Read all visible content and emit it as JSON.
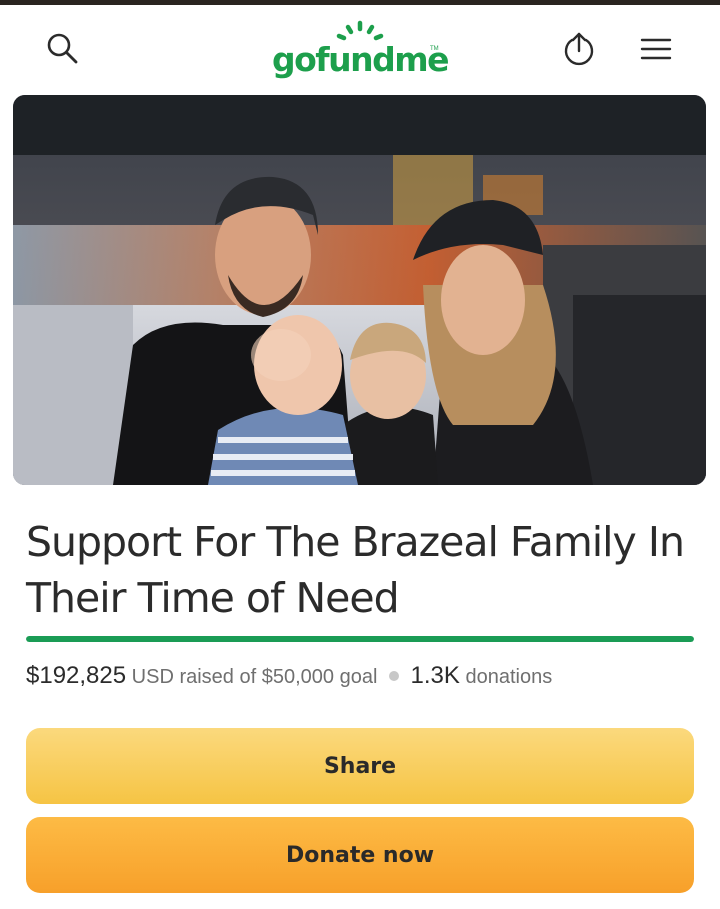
{
  "brand": {
    "logo_text": "gofundme",
    "logo_trademark": "TM",
    "color": "#1d9f4c"
  },
  "header": {
    "search_icon": "search-icon",
    "share_icon": "upload-share-icon",
    "menu_icon": "hamburger-menu-icon"
  },
  "campaign": {
    "hero_image": "family-photo",
    "title": "Support For The Brazeal Family In Their Time of Need",
    "progress_fraction": 1.0,
    "progress_color": "#1a9c55",
    "raised_amount": "$192,825",
    "raised_text": "USD raised of $50,000 goal",
    "donation_count": "1.3K",
    "donation_label": "donations"
  },
  "actions": {
    "share_label": "Share",
    "donate_label": "Donate now",
    "share_color": "#f6c444",
    "donate_color": "#f7a02a"
  }
}
